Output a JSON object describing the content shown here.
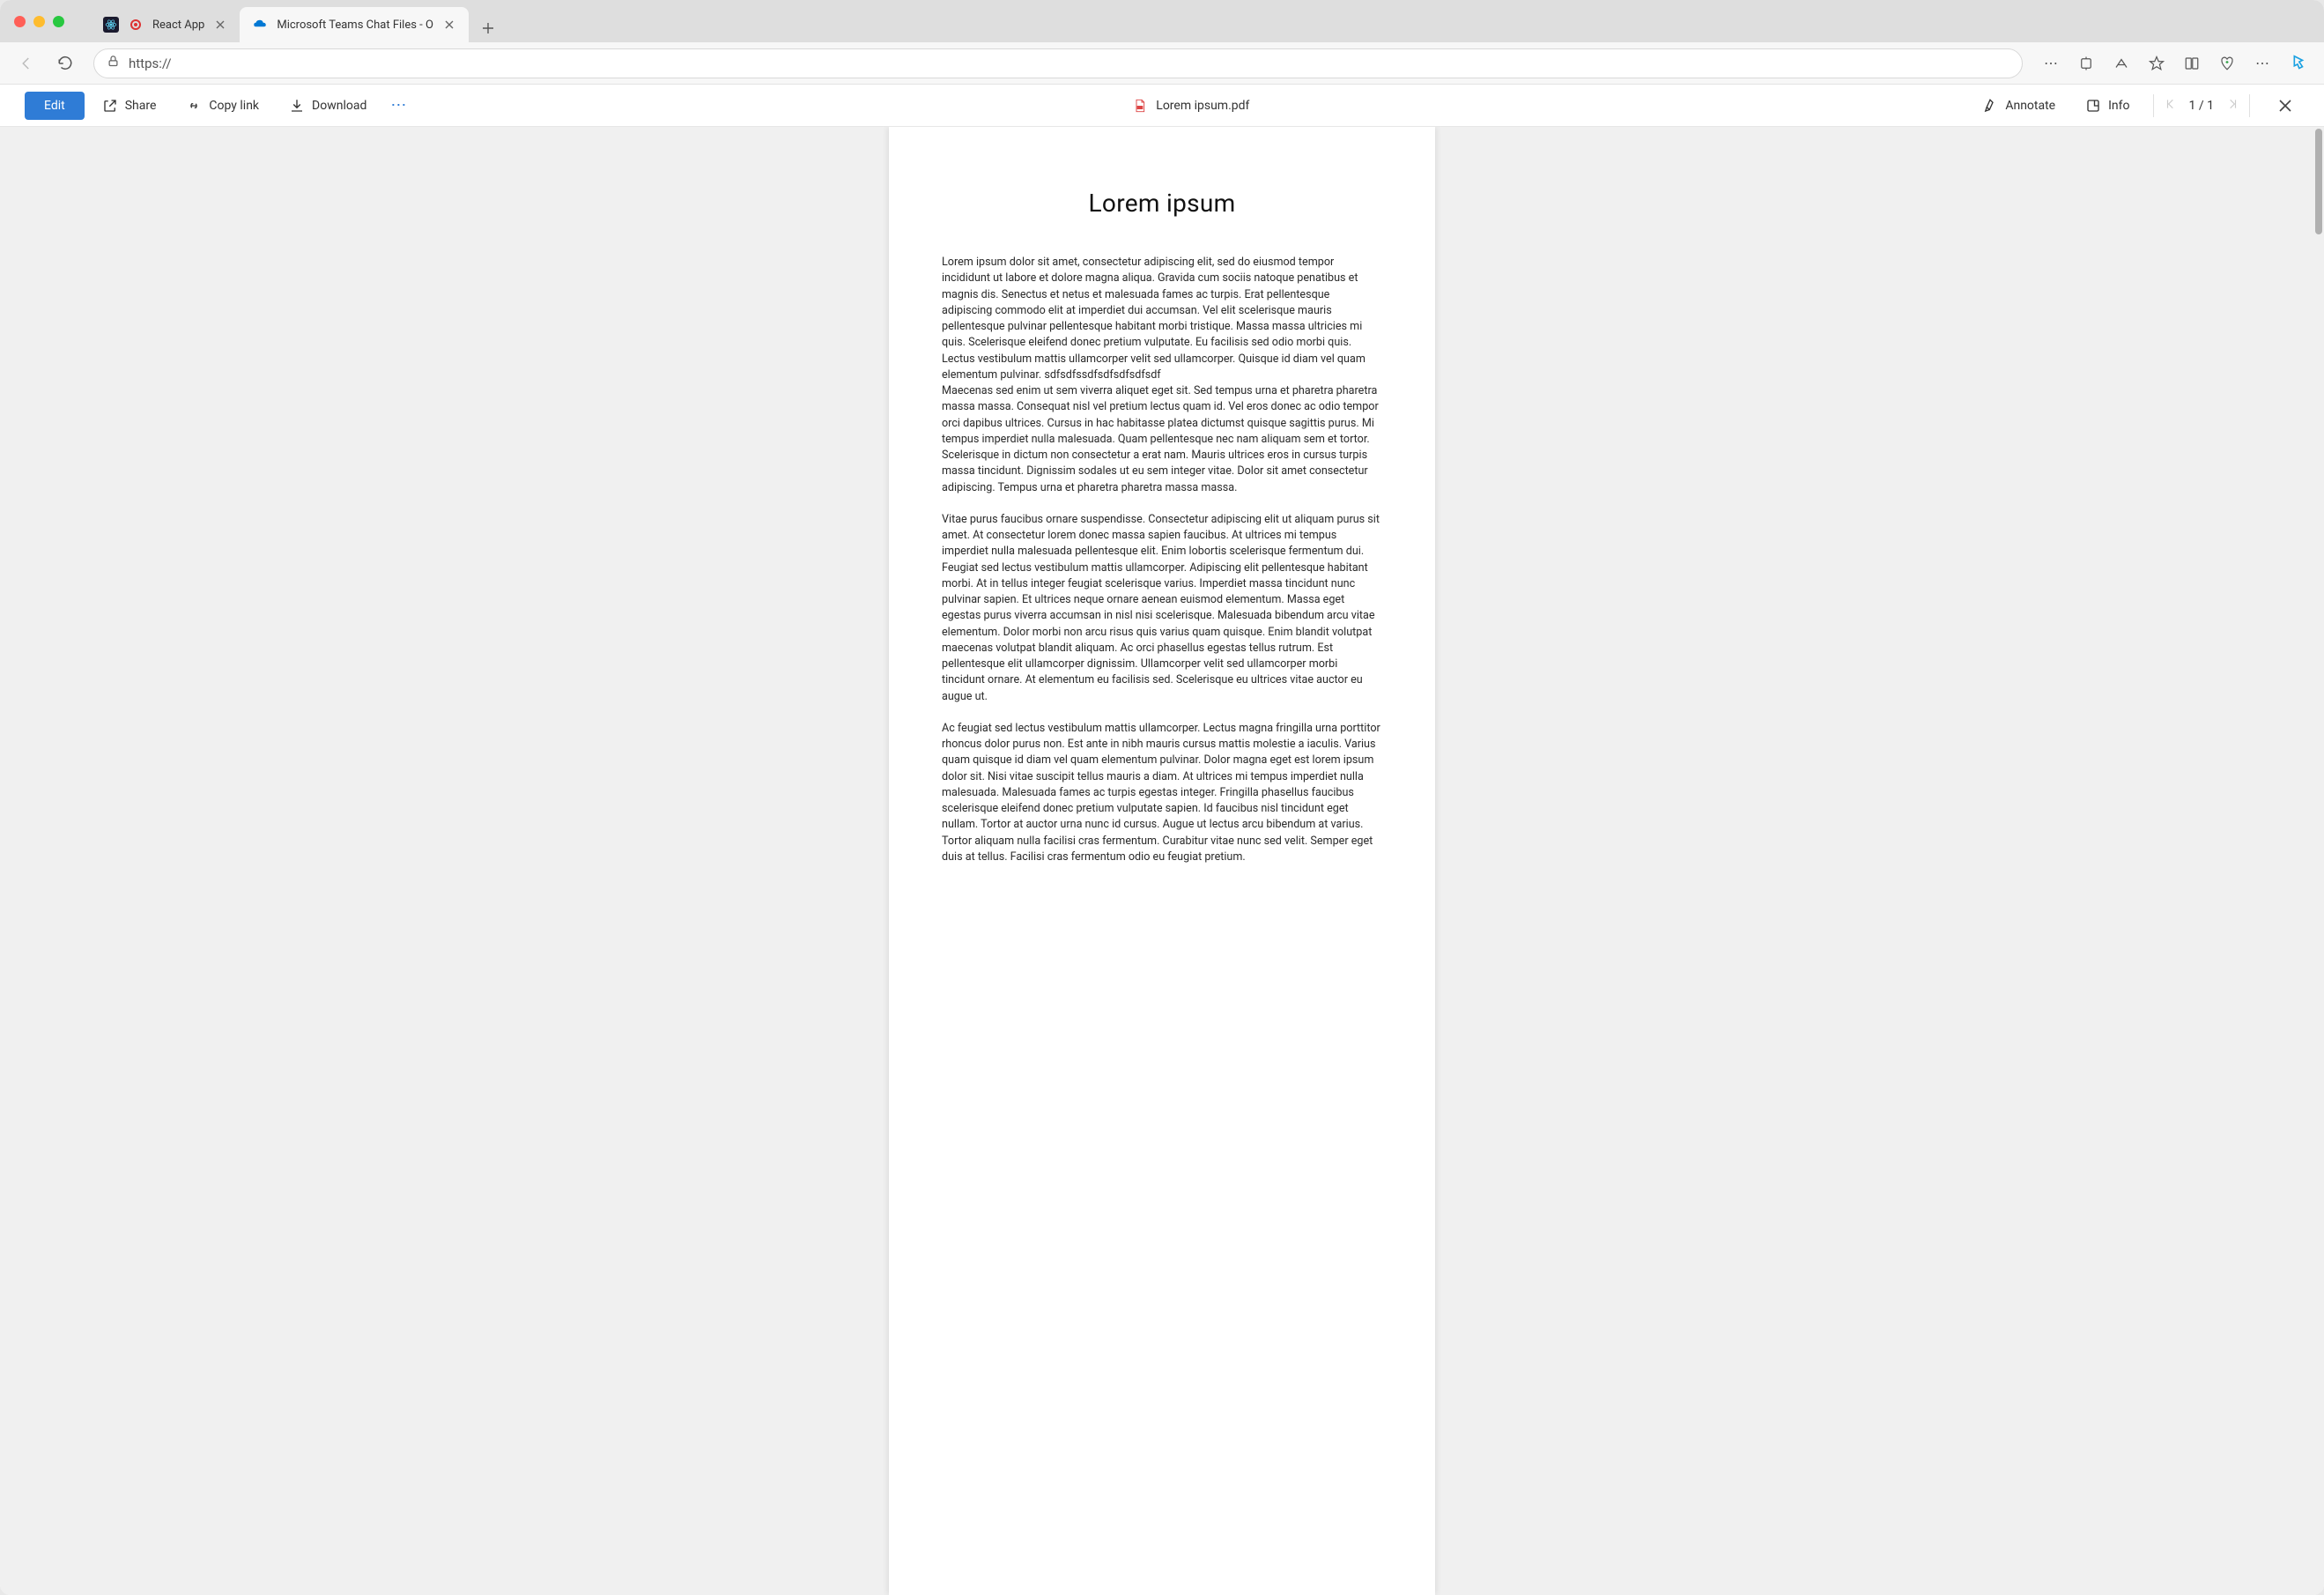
{
  "browser": {
    "tabs": [
      {
        "title": "React App",
        "active": false
      },
      {
        "title": "Microsoft Teams Chat Files - O",
        "active": true
      }
    ],
    "address_protocol": "https://",
    "address_rest": ""
  },
  "toolbar": {
    "edit_label": "Edit",
    "share_label": "Share",
    "copylink_label": "Copy link",
    "download_label": "Download",
    "annotate_label": "Annotate",
    "info_label": "Info"
  },
  "file": {
    "name": "Lorem ipsum.pdf"
  },
  "pager": {
    "current": "1",
    "sep": "/",
    "total": "1"
  },
  "document": {
    "title": "Lorem ipsum",
    "para1": "Lorem ipsum dolor sit amet, consectetur adipiscing elit, sed do eiusmod tempor incididunt ut labore et dolore magna aliqua. Gravida cum sociis natoque penatibus et magnis dis. Senectus et netus et malesuada fames ac turpis. Erat pellentesque adipiscing commodo elit at imperdiet dui accumsan. Vel elit scelerisque mauris pellentesque pulvinar pellentesque habitant morbi tristique. Massa massa ultricies mi quis. Scelerisque eleifend donec pretium vulputate. Eu facilisis sed odio morbi quis. Lectus vestibulum mattis ullamcorper velit sed ullamcorper. Quisque id diam vel quam elementum pulvinar. sdfsdfssdfsdfsdfsdfsdf",
    "para2": "Maecenas sed enim ut sem viverra aliquet eget sit. Sed tempus urna et pharetra pharetra massa massa. Consequat nisl vel pretium lectus quam id. Vel eros donec ac odio tempor orci dapibus ultrices. Cursus in hac habitasse platea dictumst quisque sagittis purus. Mi tempus imperdiet nulla malesuada. Quam pellentesque nec nam aliquam sem et tortor. Scelerisque in dictum non consectetur a erat nam. Mauris ultrices eros in cursus turpis massa tincidunt. Dignissim sodales ut eu sem integer vitae. Dolor sit amet consectetur adipiscing. Tempus urna et pharetra pharetra massa massa.",
    "para3": "Vitae purus faucibus ornare suspendisse. Consectetur adipiscing elit ut aliquam purus sit amet. At consectetur lorem donec massa sapien faucibus. At ultrices mi tempus imperdiet nulla malesuada pellentesque elit. Enim lobortis scelerisque fermentum dui. Feugiat sed lectus vestibulum mattis ullamcorper. Adipiscing elit pellentesque habitant morbi. At in tellus integer feugiat scelerisque varius. Imperdiet massa tincidunt nunc pulvinar sapien. Et ultrices neque ornare aenean euismod elementum. Massa eget egestas purus viverra accumsan in nisl nisi scelerisque. Malesuada bibendum arcu vitae elementum. Dolor morbi non arcu risus quis varius quam quisque. Enim blandit volutpat maecenas volutpat blandit aliquam. Ac orci phasellus egestas tellus rutrum. Est pellentesque elit ullamcorper dignissim. Ullamcorper velit sed ullamcorper morbi tincidunt ornare. At elementum eu facilisis sed. Scelerisque eu ultrices vitae auctor eu augue ut.",
    "para4": "Ac feugiat sed lectus vestibulum mattis ullamcorper. Lectus magna fringilla urna porttitor rhoncus dolor purus non. Est ante in nibh mauris cursus mattis molestie a iaculis. Varius quam quisque id diam vel quam elementum pulvinar. Dolor magna eget est lorem ipsum dolor sit. Nisi vitae suscipit tellus mauris a diam. At ultrices mi tempus imperdiet nulla malesuada. Malesuada fames ac turpis egestas integer. Fringilla phasellus faucibus scelerisque eleifend donec pretium vulputate sapien. Id faucibus nisl tincidunt eget nullam. Tortor at auctor urna nunc id cursus. Augue ut lectus arcu bibendum at varius. Tortor aliquam nulla facilisi cras fermentum. Curabitur vitae nunc sed velit. Semper eget duis at tellus. Facilisi cras fermentum odio eu feugiat pretium."
  }
}
